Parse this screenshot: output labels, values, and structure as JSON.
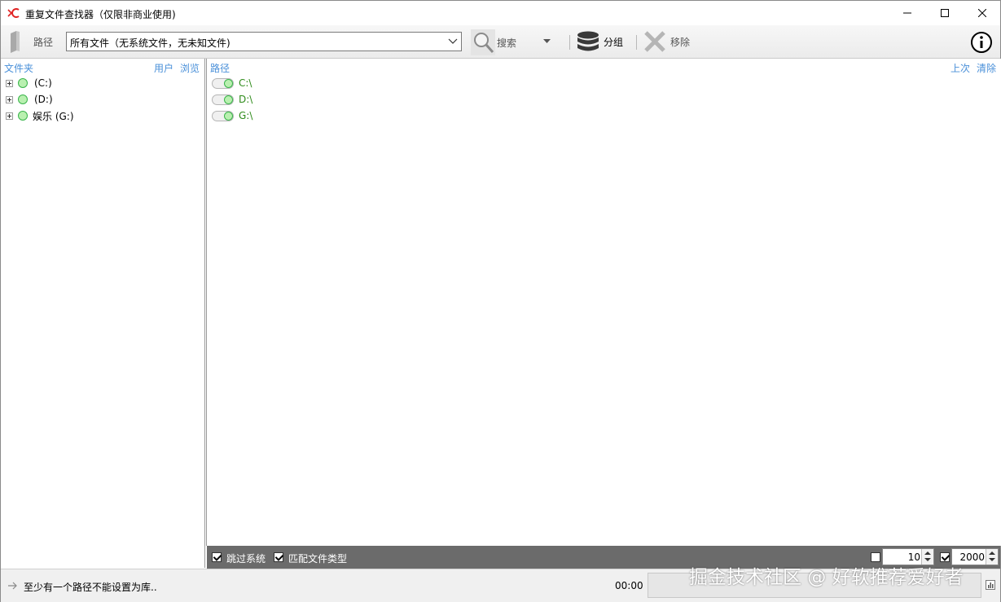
{
  "window": {
    "title": "重复文件查找器（仅限非商业使用)",
    "accent_color": "#e02020"
  },
  "toolbar": {
    "path_label": "路径",
    "filter_value": "所有文件（无系统文件，无未知文件)",
    "search_label": "搜索",
    "group_label": "分组",
    "remove_label": "移除"
  },
  "left_panel": {
    "header": "文件夹",
    "users_link": "用户",
    "browse_link": "浏览",
    "drives": [
      {
        "label": "(C:)"
      },
      {
        "label": "(D:)"
      },
      {
        "label": "娱乐 (G:)"
      }
    ]
  },
  "right_panel": {
    "header": "路径",
    "last_link": "上次",
    "clear_link": "清除",
    "paths": [
      {
        "label": "C:\\",
        "enabled": true
      },
      {
        "label": "D:\\",
        "enabled": true
      },
      {
        "label": "G:\\",
        "enabled": true
      }
    ]
  },
  "options": {
    "skip_system_label": "跳过系统",
    "skip_system_checked": true,
    "match_type_label": "匹配文件类型",
    "match_type_checked": true,
    "min_enabled": false,
    "min_value": "10",
    "max_enabled": true,
    "max_value": "2000"
  },
  "status": {
    "message": "至少有一个路径不能设置为库..",
    "time": "00:00",
    "progress_fraction": 0
  },
  "watermark": "掘金技术社区 @ 好软推荐爱好者"
}
